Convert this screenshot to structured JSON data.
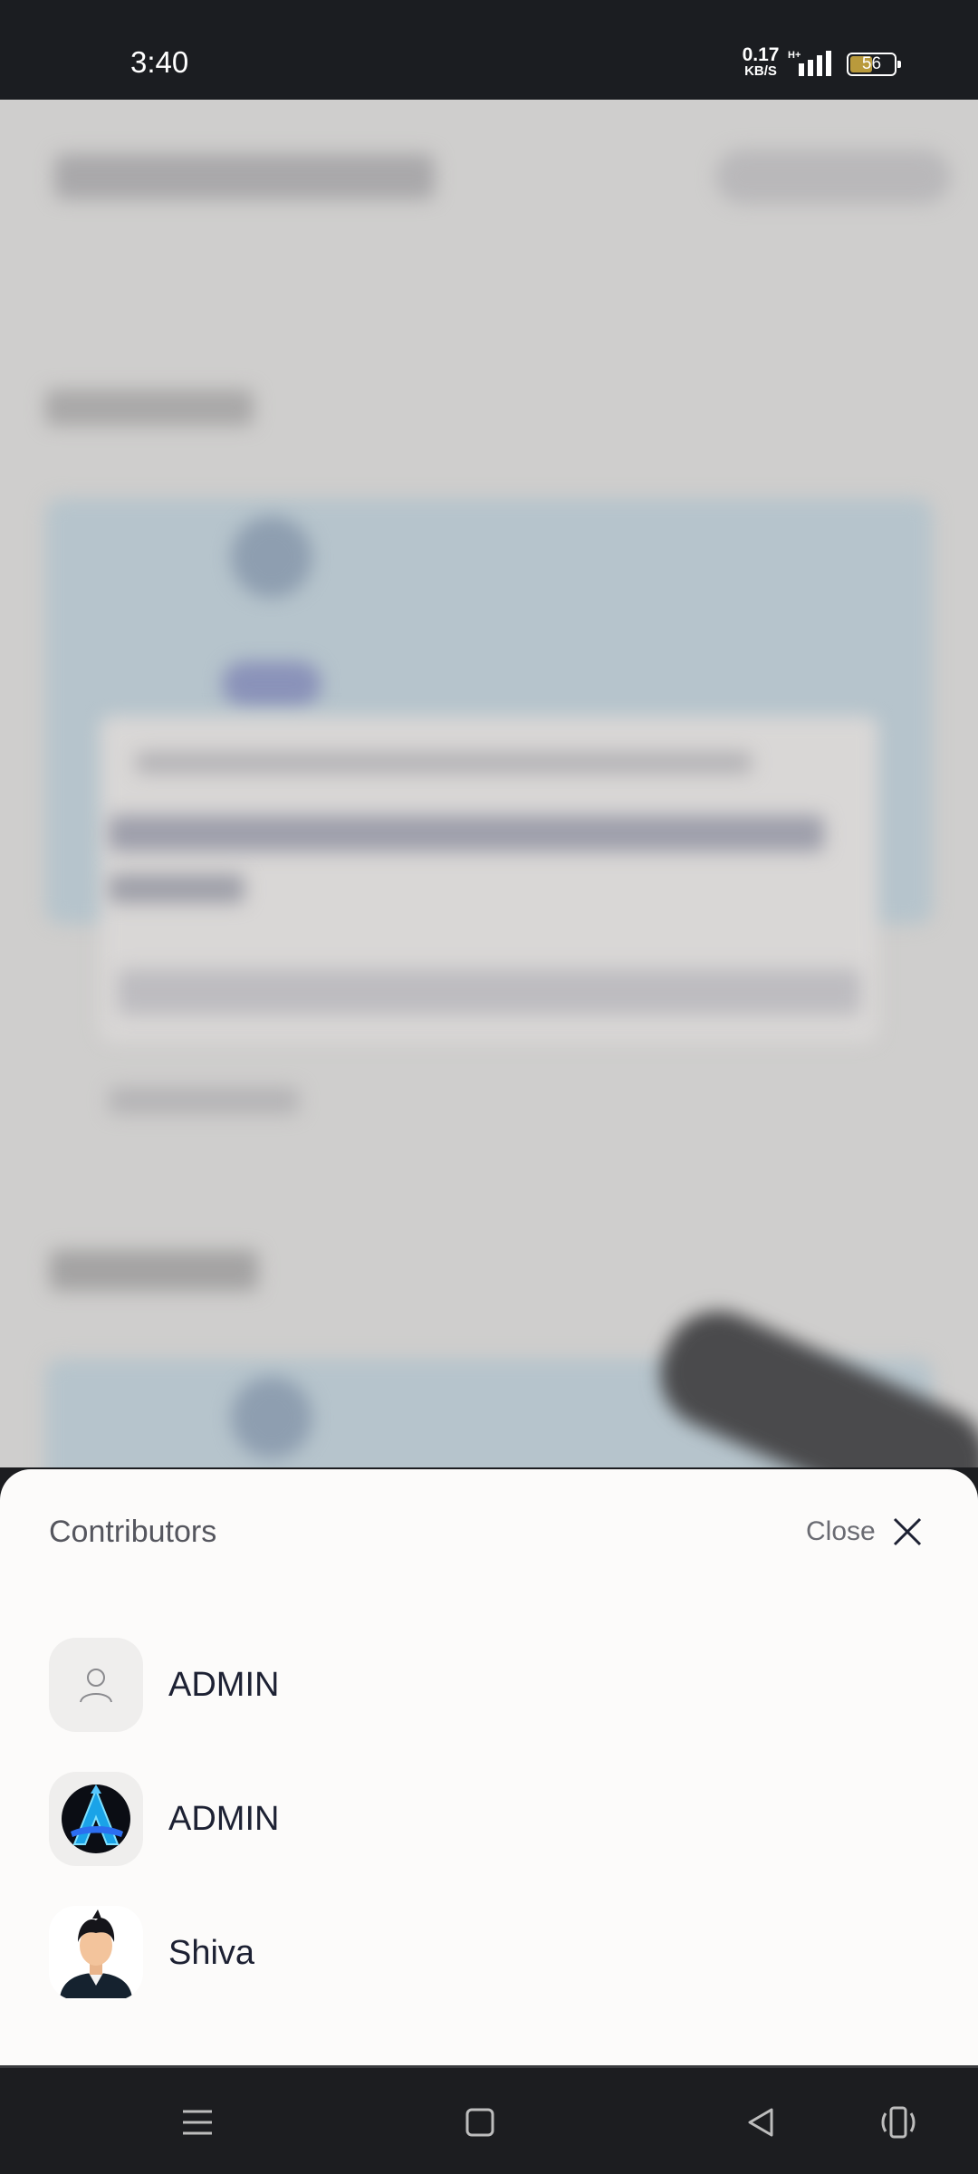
{
  "status_bar": {
    "time": "3:40",
    "network_speed_value": "0.17",
    "network_speed_unit": "KB/S",
    "network_type": "H+",
    "battery_level": "56"
  },
  "sheet": {
    "title": "Contributors",
    "close_label": "Close",
    "contributors": [
      {
        "name": "ADMIN",
        "avatar": "default-user-icon"
      },
      {
        "name": "ADMIN",
        "avatar": "blue-a-logo-icon"
      },
      {
        "name": "Shiva",
        "avatar": "cartoon-man-avatar"
      }
    ]
  },
  "nav_bar": {
    "buttons": [
      "menu-icon",
      "home-icon",
      "back-icon",
      "accessibility-icon"
    ]
  },
  "colors": {
    "sheet_background": "#fcfbfa",
    "overlay_background": "#cfcecd",
    "status_bar": "#1b1d21"
  }
}
